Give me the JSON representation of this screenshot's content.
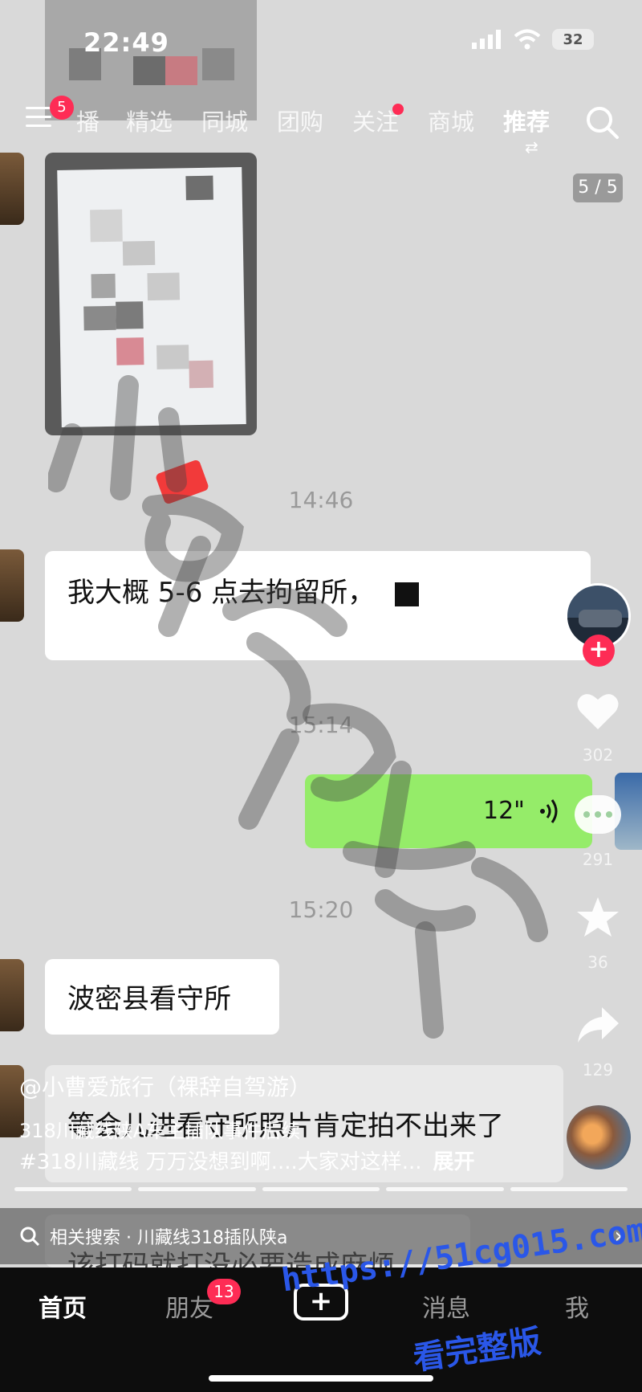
{
  "status_bar": {
    "time": "22:49",
    "battery": "32"
  },
  "top_nav": {
    "menu_badge": "5",
    "tabs": [
      {
        "label": "播"
      },
      {
        "label": "精选"
      },
      {
        "label": "同城"
      },
      {
        "label": "团购"
      },
      {
        "label": "关注"
      },
      {
        "label": "商城"
      },
      {
        "label": "推荐"
      }
    ],
    "active_tab": "推荐"
  },
  "image_counter": "5 / 5",
  "chat": {
    "times": [
      "14:46",
      "15:14",
      "15:20"
    ],
    "messages": [
      {
        "text": "我大概 5-6 点去拘留所，"
      },
      {
        "voice_duration": "12\""
      },
      {
        "text": "波密县看守所"
      },
      {
        "text": "等会儿进看守所照片肯定拍不出来了"
      },
      {
        "text": "该打码就打没必要造成麻烦"
      }
    ]
  },
  "rail": {
    "likes": "302",
    "comments": "291",
    "favorites": "36",
    "shares": "129"
  },
  "caption": {
    "author": "@小曹爱旅行（裸辞自驾游）",
    "title": "318川藏线陕A车主插队事件后续",
    "hashtags": "#318川藏线 万万没想到啊....大家对这样...",
    "expand": "展开"
  },
  "related_search": "相关搜索 · 川藏线318插队陕a",
  "bottom_nav": {
    "items": [
      {
        "label": "首页"
      },
      {
        "label": "朋友"
      },
      {
        "label": "消息"
      },
      {
        "label": "我"
      }
    ],
    "friends_badge": "13",
    "add_label": "+"
  },
  "watermark": {
    "handwritten": "小曹爱旅行",
    "site": "https://51cg015.com",
    "site_sub": "看完整版"
  },
  "colors": {
    "accent": "#fe2c55",
    "voice_bubble": "#95ec69",
    "site_watermark": "#2a57e8"
  }
}
